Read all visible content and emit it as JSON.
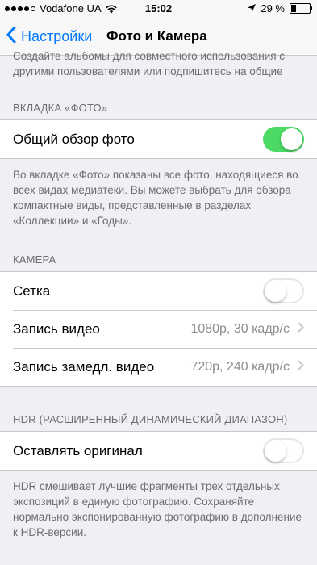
{
  "status_bar": {
    "carrier": "Vodafone UA",
    "time": "15:02",
    "battery": "29 %",
    "battery_level": 0.29
  },
  "nav": {
    "back_label": "Настройки",
    "title": "Фото и Камера"
  },
  "top_note": "Создайте альбомы для совместного использования с другими пользователями или подпишитесь на общие альбомы других пользователей.",
  "photos_tab": {
    "header": "ВКЛАДКА «ФОТО»",
    "summary_label": "Общий обзор фото",
    "summary_on": true,
    "footer": "Во вкладке «Фото» показаны все фото, находящиеся во всех видах медиатеки. Вы можете выбрать для обзора компактные виды, представленные в разделах «Коллекции» и «Годы»."
  },
  "camera": {
    "header": "КАМЕРА",
    "grid_label": "Сетка",
    "grid_on": false,
    "video_label": "Запись видео",
    "video_value": "1080p, 30 кадр/с",
    "slomo_label": "Запись замедл. видео",
    "slomo_value": "720p, 240 кадр/с"
  },
  "hdr": {
    "header": "HDR (РАСШИРЕННЫЙ ДИНАМИЧЕСКИЙ ДИАПАЗОН)",
    "keep_label": "Оставлять оригинал",
    "keep_on": false,
    "footer": "HDR смешивает лучшие фрагменты трех отдельных экспозиций в единую фотографию. Сохраняйте нормально экспонированную фотографию в дополнение к HDR-версии."
  },
  "colors": {
    "accent": "#007aff",
    "switch_on": "#4cd964",
    "background": "#efeff4"
  }
}
